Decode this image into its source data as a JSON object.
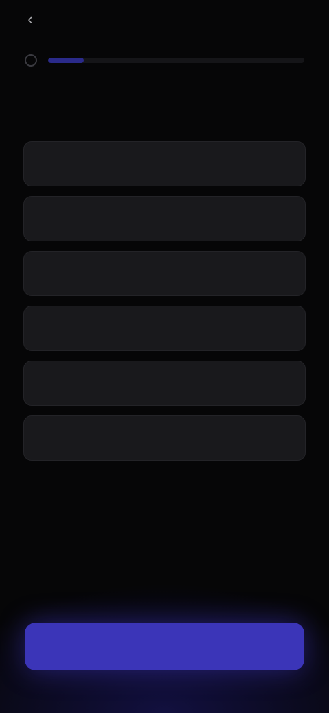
{
  "header": {
    "back_icon": "back-arrow-icon",
    "title": ""
  },
  "progress": {
    "step_icon": "step-indicator-icon",
    "fraction": 0.14,
    "fill_color": "#2a2a8a"
  },
  "question": {
    "text": ""
  },
  "options": [
    {
      "label": ""
    },
    {
      "label": ""
    },
    {
      "label": ""
    },
    {
      "label": ""
    },
    {
      "label": ""
    },
    {
      "label": ""
    }
  ],
  "cta": {
    "label": "",
    "color": "#3b35b8"
  }
}
